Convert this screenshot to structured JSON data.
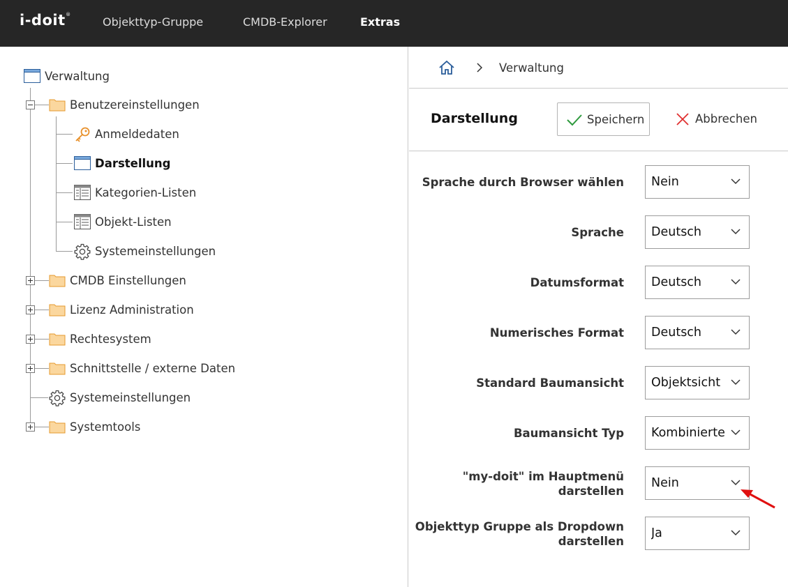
{
  "app": {
    "logo_text": "i-doit",
    "accent_color": "#f0a02a",
    "topbar_color": "#262626"
  },
  "nav": {
    "items": [
      {
        "label": "Objekttyp-Gruppe"
      },
      {
        "label": "CMDB-Explorer"
      },
      {
        "label": "Extras",
        "active": true
      }
    ]
  },
  "tree": {
    "root": {
      "label": "Verwaltung",
      "icon": "window-icon"
    },
    "items": [
      {
        "label": "Benutzereinstellungen",
        "icon": "folder-icon",
        "expanded": true
      },
      {
        "label": "Anmeldedaten",
        "icon": "key-icon"
      },
      {
        "label": "Darstellung",
        "icon": "window-icon",
        "selected": true
      },
      {
        "label": "Kategorien-Listen",
        "icon": "table-icon"
      },
      {
        "label": "Objekt-Listen",
        "icon": "table-icon"
      },
      {
        "label": "Systemeinstellungen",
        "icon": "gear-icon"
      },
      {
        "label": "CMDB Einstellungen",
        "icon": "folder-icon",
        "expanded": false
      },
      {
        "label": "Lizenz Administration",
        "icon": "folder-icon",
        "expanded": false
      },
      {
        "label": "Rechtesystem",
        "icon": "folder-icon",
        "expanded": false
      },
      {
        "label": "Schnittstelle / externe Daten",
        "icon": "folder-icon",
        "expanded": false
      },
      {
        "label": "Systemeinstellungen",
        "icon": "gear-icon"
      },
      {
        "label": "Systemtools",
        "icon": "folder-icon",
        "expanded": false
      }
    ]
  },
  "breadcrumb": {
    "home_icon": "home-icon",
    "separator_icon": "chevron-right-icon",
    "current": "Verwaltung"
  },
  "header": {
    "title": "Darstellung",
    "save_label": "Speichern",
    "cancel_label": "Abbrechen"
  },
  "form": {
    "rows": [
      {
        "label": "Sprache durch Browser wählen",
        "value": "Nein"
      },
      {
        "label": "Sprache",
        "value": "Deutsch"
      },
      {
        "label": "Datumsformat",
        "value": "Deutsch"
      },
      {
        "label": "Numerisches Format",
        "value": "Deutsch"
      },
      {
        "label": "Standard Baumansicht",
        "value": "Objektsicht"
      },
      {
        "label": "Baumansicht Typ",
        "value": "Kombinierte Ansicht"
      },
      {
        "label_line1": "\"my-doit\" im Hauptmenü",
        "label_line2": "darstellen",
        "value": "Nein"
      },
      {
        "label_line1": "Objekttyp Gruppe als Dropdown",
        "label_line2": "darstellen",
        "value": "Ja"
      }
    ]
  },
  "annotation": {
    "arrow_color": "#e01010"
  }
}
